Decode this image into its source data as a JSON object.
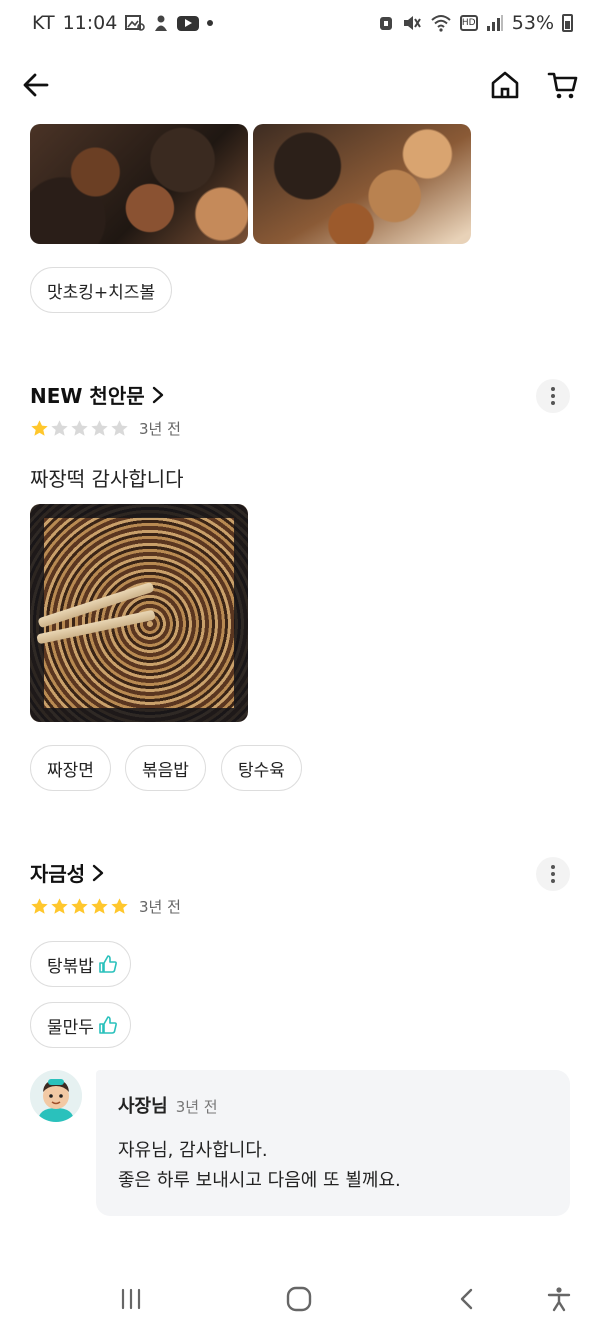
{
  "status_bar": {
    "carrier": "KT",
    "time": "11:04",
    "battery": "53%",
    "hd_label": "HD",
    "icons": [
      "gallery-icon",
      "app-icon",
      "youtube-icon",
      "dot-icon",
      "alarm-icon",
      "mute-icon",
      "wifi-icon",
      "hd-icon",
      "signal-icon",
      "battery-icon"
    ]
  },
  "app_bar": {
    "back_icon": "arrow-left-icon",
    "home_icon": "home-icon",
    "cart_icon": "cart-icon"
  },
  "reviews": [
    {
      "photos": [
        "chicken-photo",
        "chicken-photo"
      ],
      "menu_chips": [
        "맛초킹+치즈볼"
      ]
    },
    {
      "reviewer": "NEW 천안문",
      "rating": 1,
      "rating_max": 5,
      "date": "3년 전",
      "text": "짜장떡 감사합니다",
      "photos": [
        "jajangmyeon-photo"
      ],
      "menu_chips": [
        "짜장면",
        "볶음밥",
        "탕수육"
      ]
    },
    {
      "reviewer": "자금성",
      "rating": 5,
      "rating_max": 5,
      "date": "3년 전",
      "liked_chips": [
        "탕볶밥",
        "물만두"
      ],
      "owner_reply": {
        "name": "사장님",
        "date": "3년 전",
        "lines": [
          "자유님, 감사합니다.",
          "좋은 하루 보내시고 다음에 또 뵐께요."
        ]
      }
    }
  ],
  "colors": {
    "star_filled": "#ffc72c",
    "star_empty": "#d9d9d9",
    "thumb_icon": "#2ac1bc",
    "chip_border": "#dddddd",
    "reply_bg": "#f4f5f7"
  },
  "nav_bar": {
    "icons": [
      "recent-apps-icon",
      "home-circle-icon",
      "back-chevron-icon",
      "accessibility-icon"
    ]
  }
}
